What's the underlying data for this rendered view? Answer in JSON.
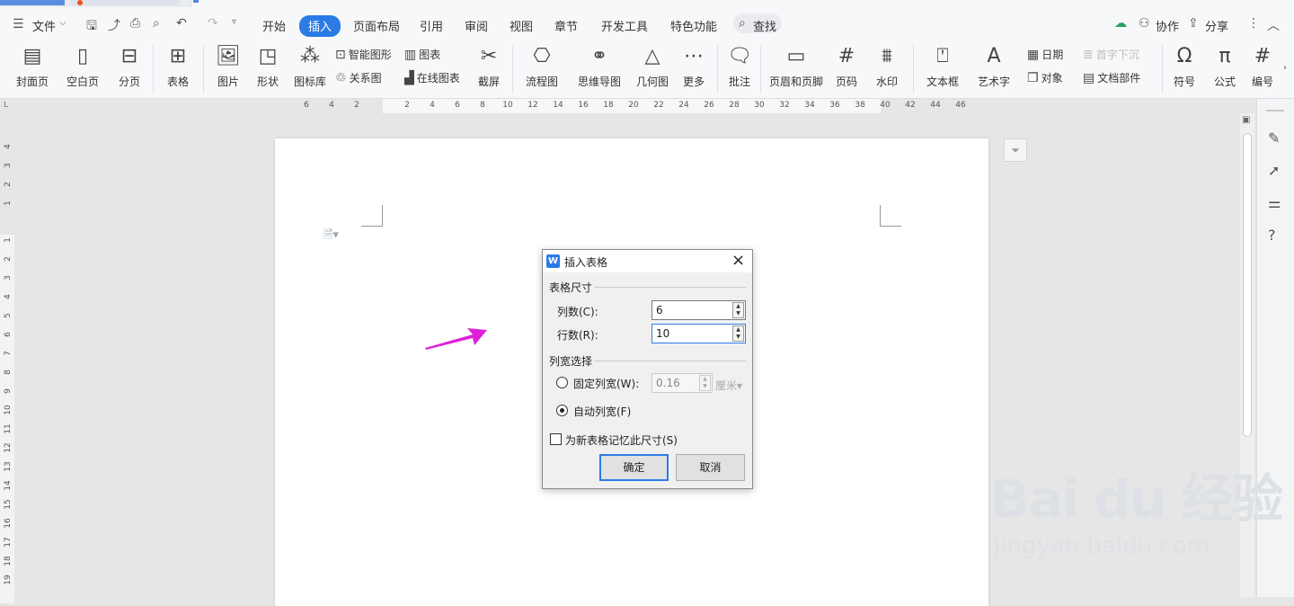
{
  "menu": {
    "file": "文件",
    "tabs": [
      "开始",
      "插入",
      "页面布局",
      "引用",
      "审阅",
      "视图",
      "章节",
      "开发工具",
      "特色功能"
    ],
    "active_tab": "插入",
    "search": "查找",
    "collab": "协作",
    "share": "分享"
  },
  "ribbon": {
    "cover": "封面页",
    "blank": "空白页",
    "pagebreak": "分页",
    "table": "表格",
    "picture": "图片",
    "shape": "形状",
    "iconlib": "图标库",
    "smartart": "智能图形",
    "chart": "图表",
    "relation": "关系图",
    "onlinechart": "在线图表",
    "screenshot": "截屏",
    "flowchart": "流程图",
    "mindmap": "思维导图",
    "geometry": "几何图",
    "more": "更多",
    "comment": "批注",
    "headerfooter": "页眉和页脚",
    "pagenum": "页码",
    "watermark": "水印",
    "textbox": "文本框",
    "wordart": "艺术字",
    "date": "日期",
    "dropcap": "首字下沉",
    "object": "对象",
    "docparts": "文档部件",
    "symbol": "符号",
    "formula": "公式",
    "numbering": "编号"
  },
  "ruler": {
    "h_ticks": [
      "6",
      "4",
      "2",
      "2",
      "4",
      "6",
      "8",
      "10",
      "12",
      "14",
      "16",
      "18",
      "20",
      "22",
      "24",
      "26",
      "28",
      "30",
      "32",
      "34",
      "36",
      "38",
      "40",
      "42",
      "44",
      "46"
    ],
    "v_ticks": [
      "4",
      "3",
      "2",
      "1",
      "1",
      "2",
      "3",
      "4",
      "5",
      "6",
      "7",
      "8",
      "9",
      "10",
      "11",
      "12",
      "13",
      "14",
      "15",
      "16",
      "17",
      "18",
      "19"
    ]
  },
  "dialog": {
    "title": "插入表格",
    "size_group": "表格尺寸",
    "cols_label": "列数(C):",
    "cols_value": "6",
    "rows_label": "行数(R):",
    "rows_value": "10",
    "width_group": "列宽选择",
    "fixed_label": "固定列宽(W):",
    "fixed_value": "0.16",
    "unit": "厘米",
    "auto_label": "自动列宽(F)",
    "remember_label": "为新表格记忆此尺寸(S)",
    "ok": "确定",
    "cancel": "取消"
  },
  "watermark": {
    "logo": "Bai du 经验",
    "url": "jingyan.baidu.com"
  },
  "colors": {
    "accent": "#2c7be5",
    "arrow": "#e020d8"
  }
}
